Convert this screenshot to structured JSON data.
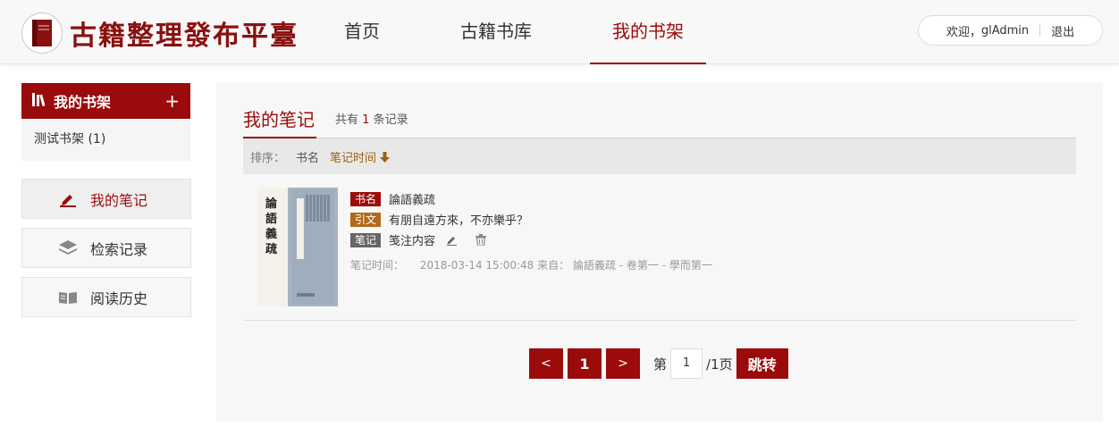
{
  "header": {
    "logo_text": "古籍整理發布平臺",
    "nav": [
      "首页",
      "古籍书库",
      "我的书架"
    ],
    "user": {
      "welcome": "欢迎，",
      "username": "glAdmin",
      "logout": "退出"
    }
  },
  "sidebar": {
    "shelf_header": "我的书架",
    "add": "+",
    "shelves": [
      "测试书架 (1)"
    ],
    "menu": [
      "我的笔记",
      "检索记录",
      "阅读历史"
    ]
  },
  "main": {
    "title": "我的笔记",
    "count_prefix": "共有",
    "count": "1",
    "count_suffix": "条记录",
    "sort": {
      "label": "排序：",
      "options": [
        "书名",
        "笔记时间"
      ]
    },
    "notes": [
      {
        "tags": [
          "书名",
          "引文",
          "笔记"
        ],
        "book": "論語義疏",
        "quote": "有朋自遠方來，不亦樂乎？",
        "note": "笺注内容",
        "time_label": "笔记时间：",
        "time": "2018-03-14 15:00:48",
        "source_label": "来自：",
        "source": "論語義疏 - 卷第一 - 學而第一",
        "cover_title": "論語義疏"
      }
    ]
  },
  "pagination": {
    "prev": "<",
    "page": "1",
    "next": ">",
    "goto_prefix": "第",
    "input_value": "1",
    "total_suffix": "/1页",
    "jump": "跳转"
  },
  "colors": {
    "brand": "#9b0b0b",
    "quote_tag": "#b06a1c",
    "note_tag": "#666666",
    "sort_active": "#9b6210"
  },
  "icons": [
    "book-logo-icon",
    "books-icon",
    "plus-icon",
    "pen-icon",
    "layers-icon",
    "open-book-icon",
    "arrow-down-icon",
    "edit-icon",
    "trash-icon"
  ]
}
